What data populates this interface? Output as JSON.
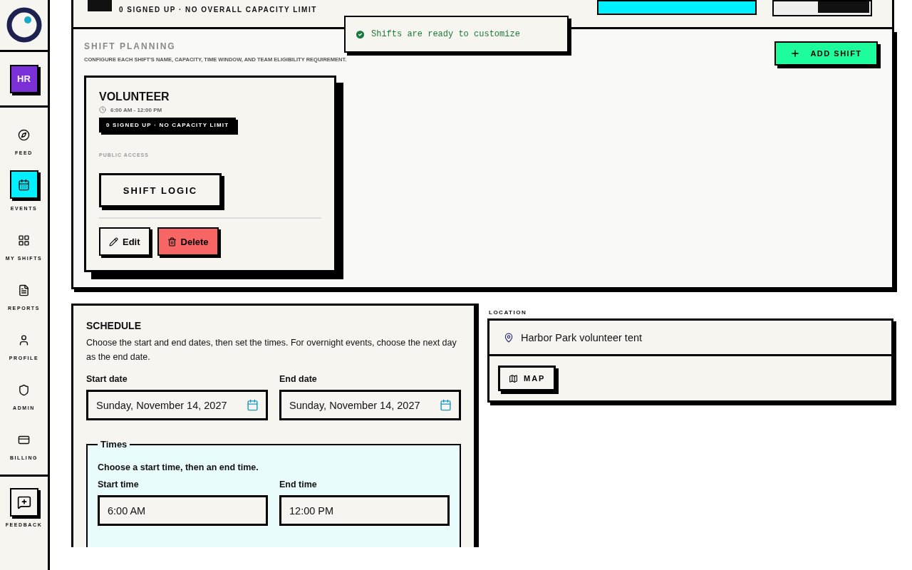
{
  "sidebar": {
    "org_badge": "HR",
    "items": [
      {
        "label": "FEED",
        "selected": false
      },
      {
        "label": "EVENTS",
        "selected": true
      },
      {
        "label": "MY SHIFTS",
        "selected": false
      },
      {
        "label": "REPORTS",
        "selected": false
      },
      {
        "label": "PROFILE",
        "selected": false
      },
      {
        "label": "ADMIN",
        "selected": false
      },
      {
        "label": "BILLING",
        "selected": false
      }
    ],
    "feedback": "FEEDBACK"
  },
  "top_card": {
    "summary": "0 SIGNED UP · NO OVERALL CAPACITY LIMIT"
  },
  "toast": {
    "message": "Shifts are ready to customize"
  },
  "shift_planning": {
    "title": "SHIFT PLANNING",
    "subtitle": "CONFIGURE EACH SHIFT'S NAME, CAPACITY, TIME WINDOW, AND TEAM ELIGIBILITY REQUIREMENT.",
    "add_button": "ADD SHIFT",
    "shifts": [
      {
        "name": "VOLUNTEER",
        "time": "6:00 AM - 12:00 PM",
        "capacity": "0 SIGNED UP · NO CAPACITY LIMIT",
        "access": "PUBLIC ACCESS",
        "logic_button": "SHIFT LOGIC",
        "edit_button": "Edit",
        "delete_button": "Delete"
      }
    ]
  },
  "schedule": {
    "title": "SCHEDULE",
    "description": "Choose the start and end dates, then set the times. For overnight events, choose the next day as the end date.",
    "start_date_label": "Start date",
    "start_date": "Sunday, November 14, 2027",
    "end_date_label": "End date",
    "end_date": "Sunday, November 14, 2027",
    "times": {
      "legend": "Times",
      "hint": "Choose a start time, then an end time.",
      "start_label": "Start time",
      "start_time": "6:00 AM",
      "end_label": "End time",
      "end_time": "12:00 PM"
    }
  },
  "location": {
    "label": "LOCATION",
    "value": "Harbor Park volunteer tent",
    "map_button": "MAP"
  }
}
